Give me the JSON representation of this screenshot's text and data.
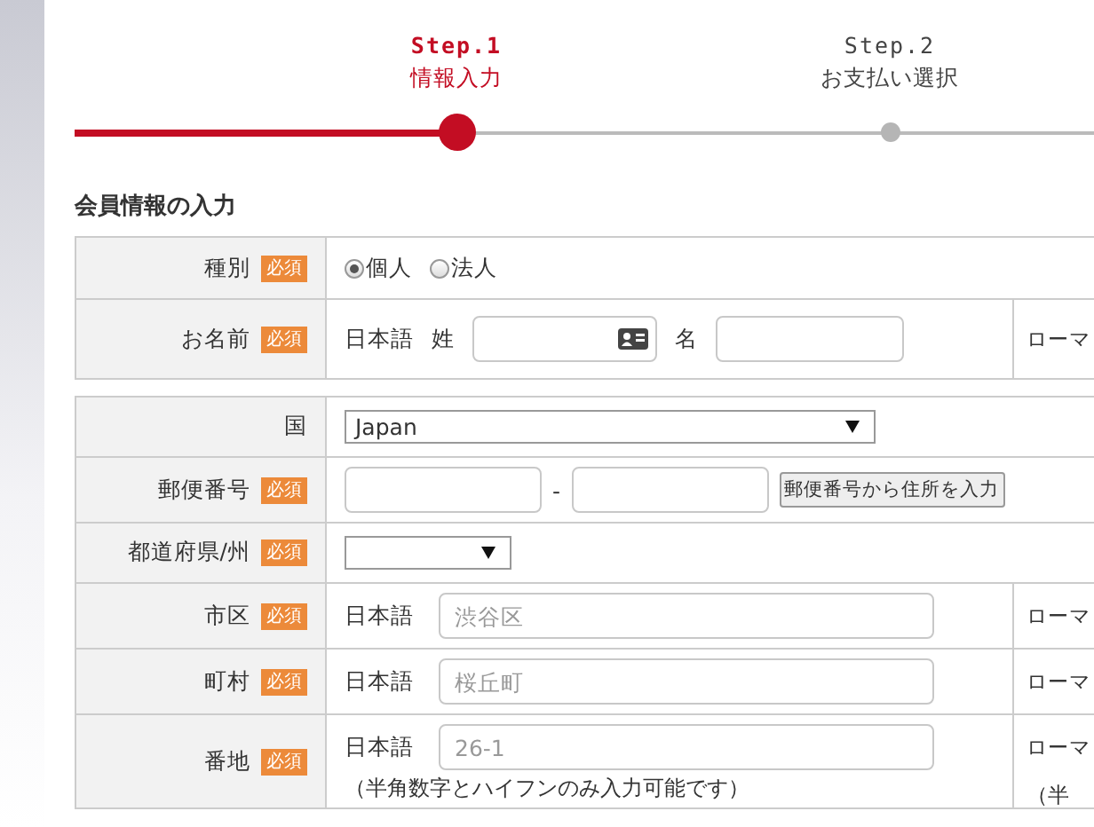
{
  "steps": [
    {
      "label": "Step.1",
      "name": "情報入力",
      "selected": true
    },
    {
      "label": "Step.2",
      "name": "お支払い選択",
      "selected": false
    }
  ],
  "section_title": "会員情報の入力",
  "tables": [
    {
      "rows": [
        {
          "kind": "radio",
          "label": "種別",
          "badge": "必須",
          "options": [
            {
              "label": "個人",
              "selected": true
            },
            {
              "label": "法人",
              "selected": false
            }
          ]
        },
        {
          "kind": "name",
          "label": "お名前",
          "badge": "必須",
          "lang": "日本語",
          "fields": [
            {
              "label": "姓"
            },
            {
              "label": "名"
            }
          ],
          "right_label": "ローマ"
        }
      ]
    },
    {
      "rows": [
        {
          "kind": "select",
          "label": "国",
          "value": "Japan"
        },
        {
          "kind": "postal",
          "label": "郵便番号",
          "badge": "必須",
          "separator": "-",
          "button": "郵便番号から住所を入力"
        },
        {
          "kind": "select",
          "label": "都道府県/州",
          "badge": "必須"
        },
        {
          "kind": "address",
          "label": "市区",
          "badge": "必須",
          "lang": "日本語",
          "placeholder": "渋谷区",
          "right_label": "ローマ"
        },
        {
          "kind": "address",
          "label": "町村",
          "badge": "必須",
          "lang": "日本語",
          "placeholder": "桜丘町",
          "right_label": "ローマ"
        },
        {
          "kind": "address",
          "label": "番地",
          "badge": "必須",
          "lang": "日本語",
          "placeholder": "26-1",
          "right_label": "ローマ",
          "note": "（半角数字とハイフンのみ入力可能です）",
          "right_note": "（半"
        }
      ]
    }
  ]
}
